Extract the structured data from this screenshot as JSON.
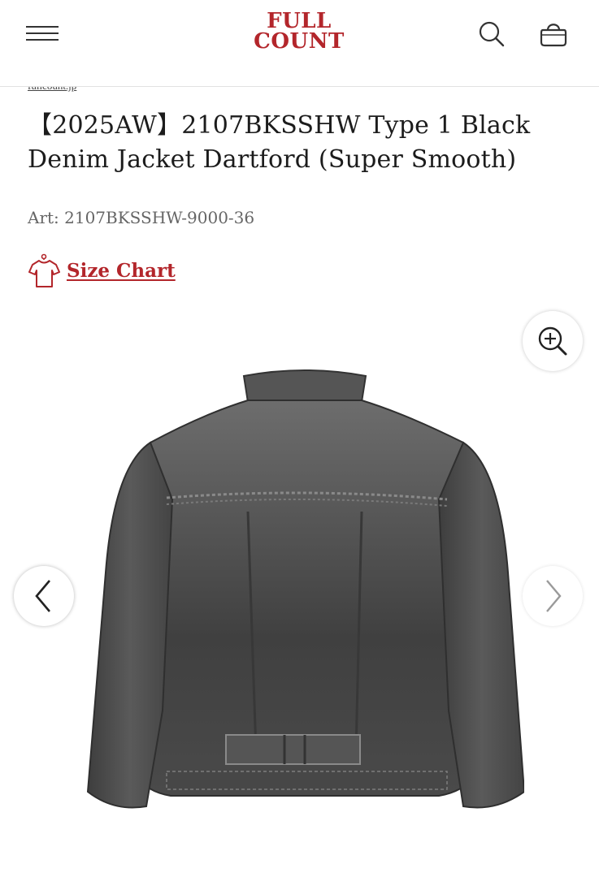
{
  "header": {
    "logo_line1": "FULL",
    "logo_line2": "COUNT",
    "menu_icon": "hamburger-menu-icon",
    "search_icon": "search-icon",
    "bag_icon": "shopping-bag-icon"
  },
  "breadcrumb_partial": "fullcount.jp",
  "product": {
    "title_line1": "【2025AW】2107BKSSHW Type 1 Black",
    "title_line2": "Denim Jacket Dartford (Super Smooth)",
    "art_number": "Art: 2107BKSSHW-9000-36",
    "size_chart_label": "Size Chart",
    "size_chart_icon": "t-shirt-icon"
  },
  "gallery": {
    "zoom_icon": "zoom-in-icon",
    "prev_icon": "chevron-left-icon",
    "next_icon": "chevron-right-icon",
    "image_subject": "black-denim-jacket-back"
  },
  "colors": {
    "brand_red": "#b3262b",
    "text": "#1c1c1c",
    "muted": "#666666"
  }
}
